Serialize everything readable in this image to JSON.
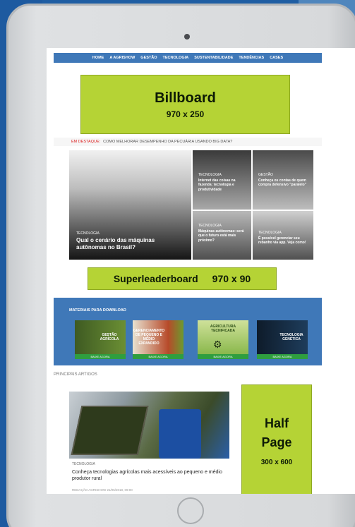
{
  "nav": {
    "items": [
      "HOME",
      "A AGRISHOW",
      "GESTÃO",
      "TECNOLOGIA",
      "SUSTENTABILIDADE",
      "TENDÊNCIAS",
      "CASES"
    ]
  },
  "ads": {
    "billboard": {
      "label": "Billboard",
      "size": "970 x 250"
    },
    "superleaderboard": {
      "label": "Superleaderboard",
      "size": "970 x 90"
    },
    "halfpage": {
      "line1": "Half",
      "line2": "Page",
      "size": "300 x 600"
    }
  },
  "destaque": {
    "label": "EM DESTAQUE:",
    "text": "COMO MELHORAR DESEMPENHO DA PECUÁRIA USANDO BIG DATA?"
  },
  "mosaic": {
    "main": {
      "category": "TECNOLOGIA",
      "title": "Qual o cenário das máquinas autônomas no Brasil?"
    },
    "a": {
      "category": "TECNOLOGIA",
      "title": "Internet das coisas na fazenda: tecnologia e produtividade"
    },
    "b": {
      "category": "GESTÃO",
      "title": "Conheça os contas de quem compra defensivo \"paralelo\""
    },
    "c": {
      "category": "TECNOLOGIA",
      "title": "Máquinas autônomas: será que o futuro está mais próximo?"
    },
    "d": {
      "category": "TECNOLOGIA",
      "title": "É possível gerenciar seu rebanho via app. Veja como!"
    }
  },
  "materials": {
    "title": "MATERIAIS PARA DOWNLOAD",
    "items": [
      {
        "cover": "GESTÃO AGRÍCOLA",
        "button": "BAIXE AGORA"
      },
      {
        "cover": "GERENCIAMENTO DE PEQUENO E MÉDIO EXPANDIDO",
        "button": "BAIXE AGORA"
      },
      {
        "cover": "AGRICULTURA TECNIFICADA",
        "button": "BAIXE AGORA"
      },
      {
        "cover": "TECNOLOGIA GENÉTICA",
        "button": "BAIXE AGORA"
      }
    ]
  },
  "principais": {
    "title": "PRINCIPAIS ARTIGOS"
  },
  "article": {
    "category": "TECNOLOGIA",
    "title": "Conheça tecnologias agrícolas mais acessíveis ao pequeno e médio produtor rural",
    "meta": "REDAÇÃO AGRISHOW 21/05/2018, 09:00"
  },
  "colors": {
    "accent": "#b5d335",
    "nav": "#3f78b8"
  }
}
